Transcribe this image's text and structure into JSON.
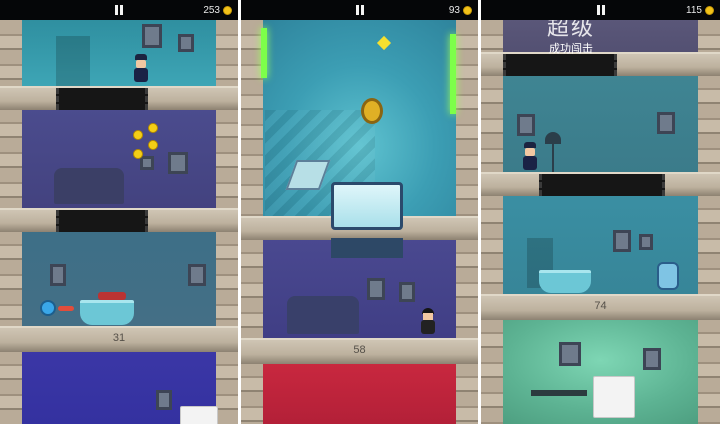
{
  "panels": [
    {
      "coin_count": "253",
      "floor_number": "31",
      "icons": [
        "pause-icon",
        "coin-icon"
      ]
    },
    {
      "coin_count": "93",
      "floor_number": "58",
      "icons": [
        "pause-icon",
        "coin-icon"
      ]
    },
    {
      "coin_count": "115",
      "floor_number": "74",
      "banner_top": "超级",
      "banner_sub": "成功闯击",
      "icons": [
        "pause-icon",
        "coin-icon"
      ]
    }
  ],
  "colors": {
    "hud_bg": "#050608",
    "coin": "#f2c21a",
    "room_teal": "#36a0b0",
    "room_purple": "#4a4a8f",
    "room_red": "#c7293f",
    "room_green": "#5fb89a",
    "slab": "#c6baa7"
  }
}
